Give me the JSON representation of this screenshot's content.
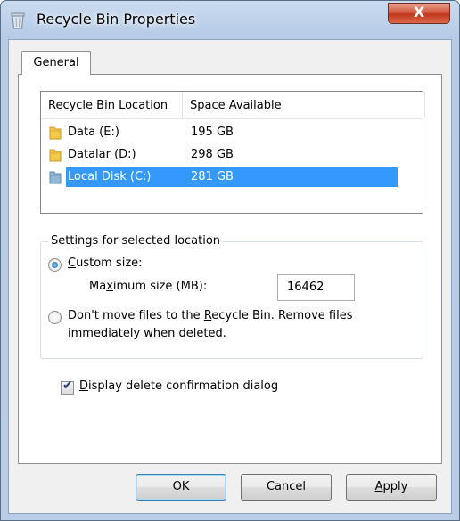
{
  "window": {
    "title": "Recycle Bin Properties",
    "close_label": "X"
  },
  "tabs": [
    {
      "label": "General",
      "selected": true
    }
  ],
  "list": {
    "columns": [
      "Recycle Bin Location",
      "Space Available"
    ],
    "rows": [
      {
        "name": "Data (E:)",
        "space": "195 GB",
        "icon": "folder-icon",
        "selected": false
      },
      {
        "name": "Datalar (D:)",
        "space": "298 GB",
        "icon": "folder-icon",
        "selected": false
      },
      {
        "name": "Local Disk (C:)",
        "space": "281 GB",
        "icon": "folder-icon",
        "selected": true
      }
    ]
  },
  "settings": {
    "group_label": "Settings for selected location",
    "custom_size_prefix": "C",
    "custom_size_rest": "ustom size:",
    "max_size_prefix": "Ma",
    "max_size_accel": "x",
    "max_size_rest": "imum size (MB):",
    "max_size_value": "16462",
    "no_recycle_line1_pre": "Don't move files to the ",
    "no_recycle_line1_accel": "R",
    "no_recycle_line1_post": "ecycle Bin. Remove files",
    "no_recycle_line2": "immediately when deleted.",
    "custom_selected": true
  },
  "confirm": {
    "accel": "D",
    "rest": "isplay delete confirmation dialog",
    "checked": true
  },
  "buttons": {
    "ok": "OK",
    "cancel": "Cancel",
    "apply_accel": "A",
    "apply_rest": "pply"
  },
  "colors": {
    "selection": "#3399ff",
    "title_gradient": "#b9cde7",
    "close_button": "#c2361c"
  }
}
